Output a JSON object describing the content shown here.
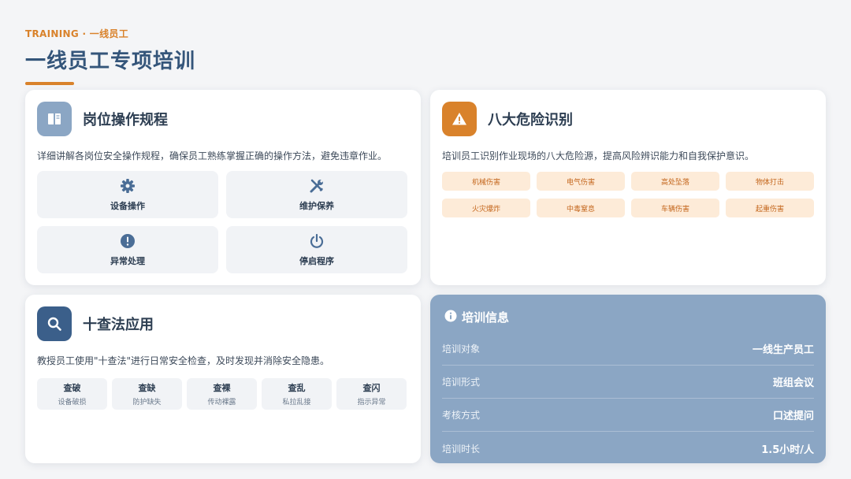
{
  "header": {
    "kicker": "TRAINING · 一线员工",
    "title": "一线员工专项培训"
  },
  "colors": {
    "accent": "#d9822b",
    "primary": "#34557a",
    "icon_blue_light": "#8ba6c4",
    "icon_blue_dark": "#3b5f8a",
    "info_bg": "#8ba6c4",
    "tag_bg": "#fdebd8"
  },
  "operations": {
    "icon": "book-icon",
    "title": "岗位操作规程",
    "desc": "详细讲解各岗位安全操作规程，确保员工熟练掌握正确的操作方法，避免违章作业。",
    "items": [
      {
        "label": "设备操作",
        "icon": "gear-icon"
      },
      {
        "label": "维护保养",
        "icon": "wrench-screwdriver-icon"
      },
      {
        "label": "异常处理",
        "icon": "alert-circle-icon"
      },
      {
        "label": "停启程序",
        "icon": "power-icon"
      }
    ]
  },
  "hazards": {
    "icon": "warning-triangle-icon",
    "title": "八大危险识别",
    "desc": "培训员工识别作业现场的八大危险源，提高风险辨识能力和自我保护意识。",
    "tags": [
      "机械伤害",
      "电气伤害",
      "高处坠落",
      "物体打击",
      "火灾爆炸",
      "中毒窒息",
      "车辆伤害",
      "起重伤害"
    ]
  },
  "ten_checks": {
    "icon": "search-icon",
    "title": "十查法应用",
    "desc": "教授员工使用\"十查法\"进行日常安全检查，及时发现并消除安全隐患。",
    "items": [
      {
        "main": "查破",
        "sub": "设备破损"
      },
      {
        "main": "查缺",
        "sub": "防护缺失"
      },
      {
        "main": "查裸",
        "sub": "传动裸露"
      },
      {
        "main": "查乱",
        "sub": "私拉乱接"
      },
      {
        "main": "查闪",
        "sub": "指示异常"
      }
    ]
  },
  "info": {
    "icon": "info-icon",
    "title": "培训信息",
    "rows": [
      {
        "key": "培训对象",
        "value": "一线生产员工"
      },
      {
        "key": "培训形式",
        "value": "班组会议"
      },
      {
        "key": "考核方式",
        "value": "口述提问"
      },
      {
        "key": "培训时长",
        "value": "1.5小时/人"
      }
    ]
  }
}
